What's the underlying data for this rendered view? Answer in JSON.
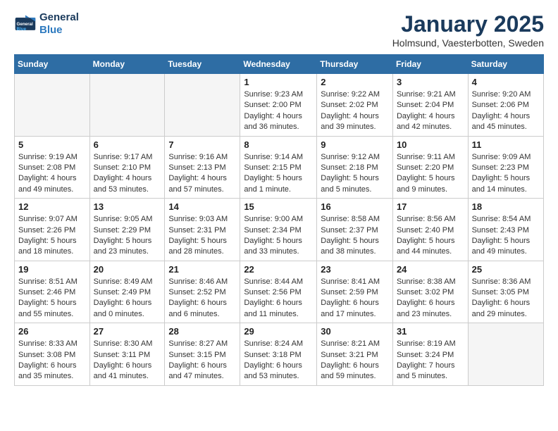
{
  "logo": {
    "line1": "General",
    "line2": "Blue"
  },
  "title": "January 2025",
  "location": "Holmsund, Vaesterbotten, Sweden",
  "weekdays": [
    "Sunday",
    "Monday",
    "Tuesday",
    "Wednesday",
    "Thursday",
    "Friday",
    "Saturday"
  ],
  "weeks": [
    [
      {
        "day": "",
        "info": ""
      },
      {
        "day": "",
        "info": ""
      },
      {
        "day": "",
        "info": ""
      },
      {
        "day": "1",
        "info": "Sunrise: 9:23 AM\nSunset: 2:00 PM\nDaylight: 4 hours\nand 36 minutes."
      },
      {
        "day": "2",
        "info": "Sunrise: 9:22 AM\nSunset: 2:02 PM\nDaylight: 4 hours\nand 39 minutes."
      },
      {
        "day": "3",
        "info": "Sunrise: 9:21 AM\nSunset: 2:04 PM\nDaylight: 4 hours\nand 42 minutes."
      },
      {
        "day": "4",
        "info": "Sunrise: 9:20 AM\nSunset: 2:06 PM\nDaylight: 4 hours\nand 45 minutes."
      }
    ],
    [
      {
        "day": "5",
        "info": "Sunrise: 9:19 AM\nSunset: 2:08 PM\nDaylight: 4 hours\nand 49 minutes."
      },
      {
        "day": "6",
        "info": "Sunrise: 9:17 AM\nSunset: 2:10 PM\nDaylight: 4 hours\nand 53 minutes."
      },
      {
        "day": "7",
        "info": "Sunrise: 9:16 AM\nSunset: 2:13 PM\nDaylight: 4 hours\nand 57 minutes."
      },
      {
        "day": "8",
        "info": "Sunrise: 9:14 AM\nSunset: 2:15 PM\nDaylight: 5 hours\nand 1 minute."
      },
      {
        "day": "9",
        "info": "Sunrise: 9:12 AM\nSunset: 2:18 PM\nDaylight: 5 hours\nand 5 minutes."
      },
      {
        "day": "10",
        "info": "Sunrise: 9:11 AM\nSunset: 2:20 PM\nDaylight: 5 hours\nand 9 minutes."
      },
      {
        "day": "11",
        "info": "Sunrise: 9:09 AM\nSunset: 2:23 PM\nDaylight: 5 hours\nand 14 minutes."
      }
    ],
    [
      {
        "day": "12",
        "info": "Sunrise: 9:07 AM\nSunset: 2:26 PM\nDaylight: 5 hours\nand 18 minutes."
      },
      {
        "day": "13",
        "info": "Sunrise: 9:05 AM\nSunset: 2:29 PM\nDaylight: 5 hours\nand 23 minutes."
      },
      {
        "day": "14",
        "info": "Sunrise: 9:03 AM\nSunset: 2:31 PM\nDaylight: 5 hours\nand 28 minutes."
      },
      {
        "day": "15",
        "info": "Sunrise: 9:00 AM\nSunset: 2:34 PM\nDaylight: 5 hours\nand 33 minutes."
      },
      {
        "day": "16",
        "info": "Sunrise: 8:58 AM\nSunset: 2:37 PM\nDaylight: 5 hours\nand 38 minutes."
      },
      {
        "day": "17",
        "info": "Sunrise: 8:56 AM\nSunset: 2:40 PM\nDaylight: 5 hours\nand 44 minutes."
      },
      {
        "day": "18",
        "info": "Sunrise: 8:54 AM\nSunset: 2:43 PM\nDaylight: 5 hours\nand 49 minutes."
      }
    ],
    [
      {
        "day": "19",
        "info": "Sunrise: 8:51 AM\nSunset: 2:46 PM\nDaylight: 5 hours\nand 55 minutes."
      },
      {
        "day": "20",
        "info": "Sunrise: 8:49 AM\nSunset: 2:49 PM\nDaylight: 6 hours\nand 0 minutes."
      },
      {
        "day": "21",
        "info": "Sunrise: 8:46 AM\nSunset: 2:52 PM\nDaylight: 6 hours\nand 6 minutes."
      },
      {
        "day": "22",
        "info": "Sunrise: 8:44 AM\nSunset: 2:56 PM\nDaylight: 6 hours\nand 11 minutes."
      },
      {
        "day": "23",
        "info": "Sunrise: 8:41 AM\nSunset: 2:59 PM\nDaylight: 6 hours\nand 17 minutes."
      },
      {
        "day": "24",
        "info": "Sunrise: 8:38 AM\nSunset: 3:02 PM\nDaylight: 6 hours\nand 23 minutes."
      },
      {
        "day": "25",
        "info": "Sunrise: 8:36 AM\nSunset: 3:05 PM\nDaylight: 6 hours\nand 29 minutes."
      }
    ],
    [
      {
        "day": "26",
        "info": "Sunrise: 8:33 AM\nSunset: 3:08 PM\nDaylight: 6 hours\nand 35 minutes."
      },
      {
        "day": "27",
        "info": "Sunrise: 8:30 AM\nSunset: 3:11 PM\nDaylight: 6 hours\nand 41 minutes."
      },
      {
        "day": "28",
        "info": "Sunrise: 8:27 AM\nSunset: 3:15 PM\nDaylight: 6 hours\nand 47 minutes."
      },
      {
        "day": "29",
        "info": "Sunrise: 8:24 AM\nSunset: 3:18 PM\nDaylight: 6 hours\nand 53 minutes."
      },
      {
        "day": "30",
        "info": "Sunrise: 8:21 AM\nSunset: 3:21 PM\nDaylight: 6 hours\nand 59 minutes."
      },
      {
        "day": "31",
        "info": "Sunrise: 8:19 AM\nSunset: 3:24 PM\nDaylight: 7 hours\nand 5 minutes."
      },
      {
        "day": "",
        "info": ""
      }
    ]
  ]
}
